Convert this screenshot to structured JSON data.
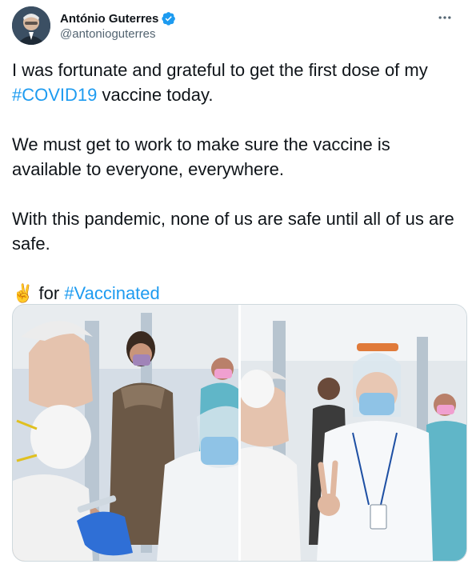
{
  "author": {
    "name": "António Guterres",
    "handle": "@antonioguterres",
    "verified_badge_color": "#1d9bf0"
  },
  "icons": {
    "avatar": "avatar-photo",
    "verified": "verified-badge-icon",
    "more": "more-horizontal-icon"
  },
  "tweet": {
    "p1_before": "I was fortunate and grateful to get the first dose of my ",
    "p1_hashtag": "#COVID19",
    "p1_after": " vaccine today.",
    "p2": "We must get to work to make sure the vaccine is available to everyone, everywhere.",
    "p3": "With this pandemic, none of us are safe until all of us are safe.",
    "p4_emoji": "✌️",
    "p4_text": " for ",
    "p4_hashtag": "#Vaccinated"
  },
  "colors": {
    "text": "#0f1419",
    "secondary": "#536471",
    "link": "#1d9bf0"
  },
  "media": {
    "photos": [
      {
        "description_icon": "photo-left"
      },
      {
        "description_icon": "photo-right"
      }
    ]
  }
}
